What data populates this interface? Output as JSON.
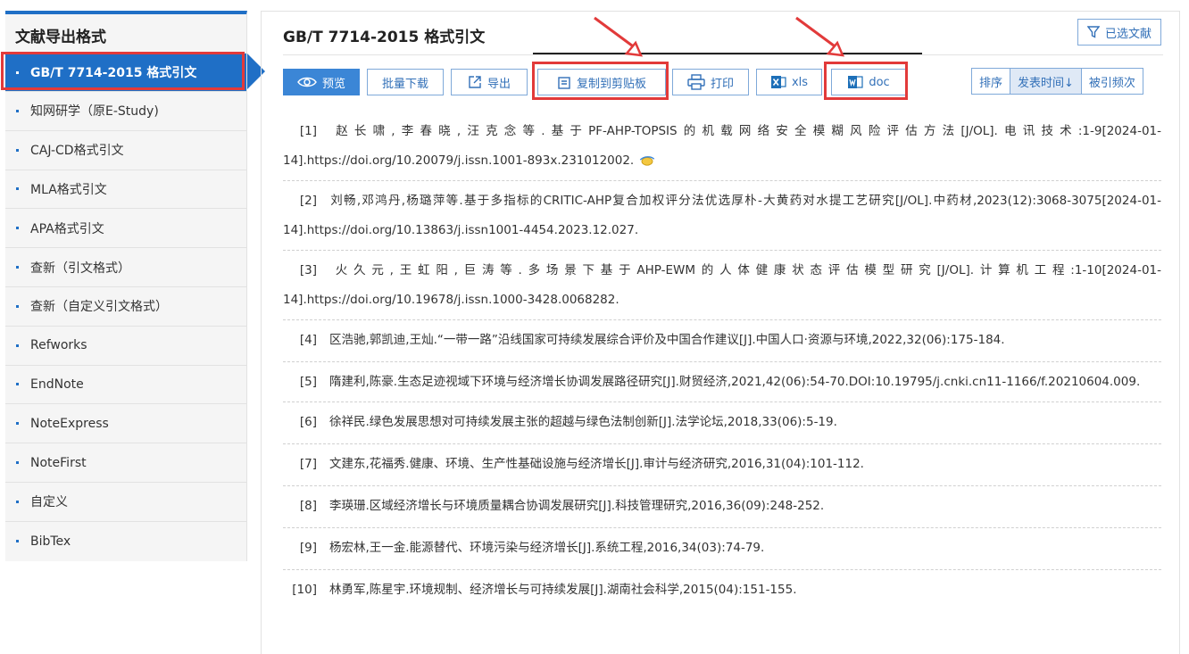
{
  "sidebar": {
    "title": "文献导出格式",
    "items": [
      {
        "label": "GB/T 7714-2015 格式引文",
        "active": true
      },
      {
        "label": "知网研学（原E-Study)"
      },
      {
        "label": "CAJ-CD格式引文"
      },
      {
        "label": "MLA格式引文"
      },
      {
        "label": "APA格式引文"
      },
      {
        "label": "查新（引文格式）"
      },
      {
        "label": "查新（自定义引文格式）"
      },
      {
        "label": "Refworks"
      },
      {
        "label": "EndNote"
      },
      {
        "label": "NoteExpress"
      },
      {
        "label": "NoteFirst"
      },
      {
        "label": "自定义"
      },
      {
        "label": "BibTex"
      }
    ]
  },
  "main": {
    "title": "GB/T 7714-2015 格式引文",
    "selected_label": "已选文献",
    "toolbar": {
      "preview": "预览",
      "batch_download": "批量下载",
      "export": "导出",
      "copy_clipboard": "复制到剪贴板",
      "print": "打印",
      "xls": "xls",
      "doc": "doc"
    },
    "sort": {
      "sort_label": "排序",
      "pub_time": "发表时间↓",
      "cited": "被引频次"
    },
    "references": [
      {
        "num": "[1]",
        "text": "赵长啸,李春晓,汪克念等.基于PF-AHP-TOPSIS的机载网络安全模糊风险评估方法[J/OL].电讯技术:1-9[2024-01-14].https://doi.org/10.20079/j.issn.1001-893x.231012002."
      },
      {
        "num": "[2]",
        "text": "刘畅,邓鸿丹,杨璐萍等.基于多指标的CRITIC-AHP复合加权评分法优选厚朴-大黄药对水提工艺研究[J/OL].中药材,2023(12):3068-3075[2024-01-14].https://doi.org/10.13863/j.issn1001-4454.2023.12.027."
      },
      {
        "num": "[3]",
        "text": "火久元,王虹阳,巨涛等.多场景下基于AHP-EWM的人体健康状态评估模型研究[J/OL].计算机工程:1-10[2024-01-14].https://doi.org/10.19678/j.issn.1000-3428.0068282."
      },
      {
        "num": "[4]",
        "text": "区浩驰,郭凯迪,王灿.“一带一路”沿线国家可持续发展综合评价及中国合作建议[J].中国人口·资源与环境,2022,32(06):175-184."
      },
      {
        "num": "[5]",
        "text": "隋建利,陈豪.生态足迹视域下环境与经济增长协调发展路径研究[J].财贸经济,2021,42(06):54-70.DOI:10.19795/j.cnki.cn11-1166/f.20210604.009."
      },
      {
        "num": "[6]",
        "text": "徐祥民.绿色发展思想对可持续发展主张的超越与绿色法制创新[J].法学论坛,2018,33(06):5-19."
      },
      {
        "num": "[7]",
        "text": "文建东,花福秀.健康、环境、生产性基础设施与经济增长[J].审计与经济研究,2016,31(04):101-112."
      },
      {
        "num": "[8]",
        "text": "李瑛珊.区域经济增长与环境质量耦合协调发展研究[J].科技管理研究,2016,36(09):248-252."
      },
      {
        "num": "[9]",
        "text": "杨宏林,王一金.能源替代、环境污染与经济增长[J].系统工程,2016,34(03):74-79."
      },
      {
        "num": "[10]",
        "text": "林勇军,陈星宇.环境规制、经济增长与可持续发展[J].湖南社会科学,2015(04):151-155."
      }
    ]
  }
}
